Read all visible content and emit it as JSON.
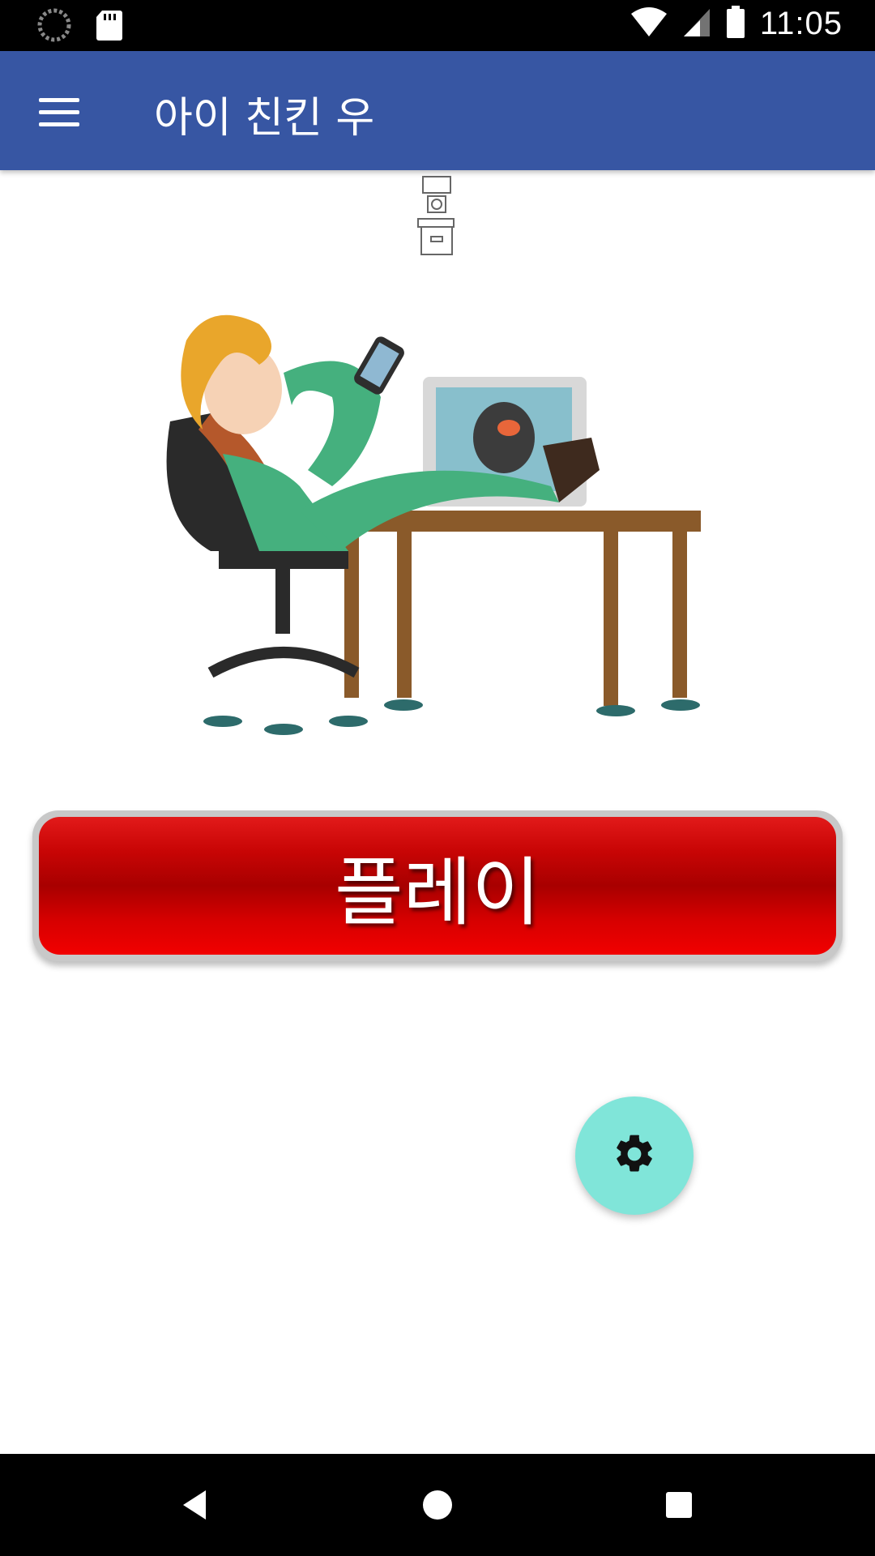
{
  "status_bar": {
    "time": "11:05",
    "icons": [
      "loading-circle-icon",
      "sd-card-icon",
      "wifi-icon",
      "signal-icon",
      "battery-icon"
    ]
  },
  "app_bar": {
    "title": "아이 친킨 우",
    "menu_icon": "hamburger-menu-icon",
    "color": "#3756A3"
  },
  "main": {
    "play_button_label": "플레이",
    "play_button_color": "#C80505",
    "settings_icon": "gear-icon",
    "fab_color": "#80E5D9"
  },
  "nav_bar": {
    "icons": [
      "back-icon",
      "home-icon",
      "recents-icon"
    ]
  }
}
